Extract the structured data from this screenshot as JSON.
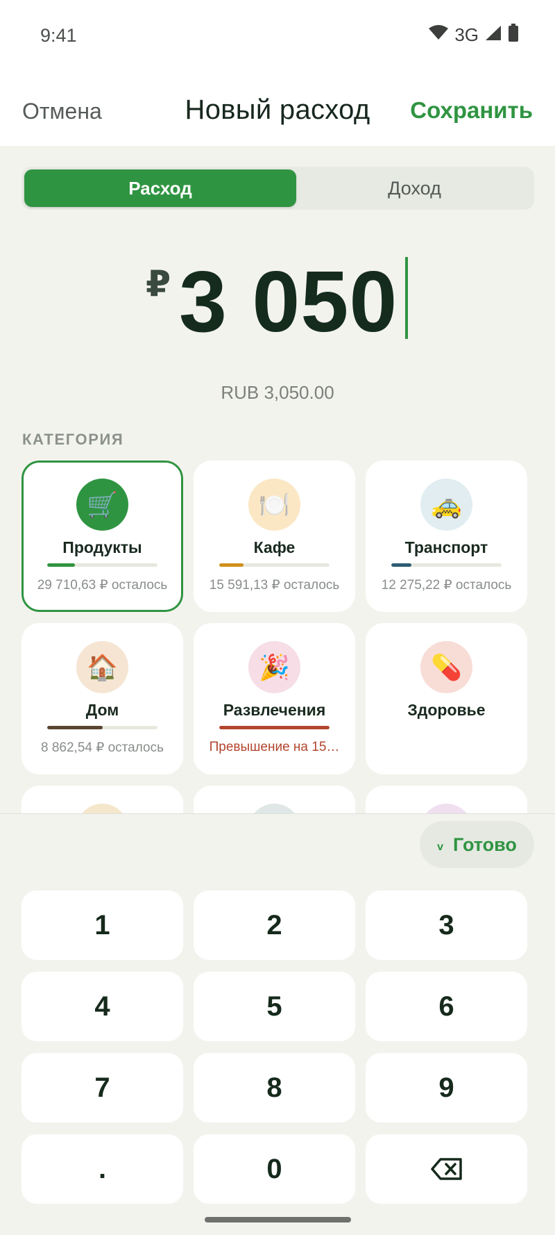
{
  "status_bar": {
    "time": "9:41",
    "network": "3G"
  },
  "header": {
    "cancel_label": "Отмена",
    "title": "Новый расход",
    "save_label": "Сохранить"
  },
  "type_switch": {
    "expense_label": "Расход",
    "income_label": "Доход",
    "selected": "expense"
  },
  "amount": {
    "currency_symbol": "₽",
    "value": "3 050",
    "formatted": "RUB 3,050.00"
  },
  "category_section": {
    "label": "КАТЕГОРИЯ",
    "items": [
      {
        "name": "Продукты",
        "icon": "🛒",
        "icon_name": "shopping-cart-icon",
        "subtitle": "29 710,63 ₽ осталось",
        "progress": 0.25,
        "bar_color": "#2f9441",
        "icon_bg": "#2f9441",
        "selected": true,
        "over_budget": false
      },
      {
        "name": "Кафе",
        "icon": "🍽️",
        "icon_name": "plate-cutlery-icon",
        "subtitle": "15 591,13 ₽ осталось",
        "progress": 0.22,
        "bar_color": "#d0901c",
        "icon_bg": "#fbe7c4",
        "selected": false,
        "over_budget": false
      },
      {
        "name": "Транспорт",
        "icon": "🚕",
        "icon_name": "taxi-icon",
        "subtitle": "12 275,22 ₽ осталось",
        "progress": 0.18,
        "bar_color": "#2d5d74",
        "icon_bg": "#e1edf1",
        "selected": false,
        "over_budget": false
      },
      {
        "name": "Дом",
        "icon": "🏠",
        "icon_name": "house-icon",
        "subtitle": "8 862,54 ₽ осталось",
        "progress": 0.5,
        "bar_color": "#5b4530",
        "icon_bg": "#f5e5d2",
        "selected": false,
        "over_budget": false
      },
      {
        "name": "Развлечения",
        "icon": "🎉",
        "icon_name": "party-popper-icon",
        "subtitle": "Превышение на 15…",
        "progress": 1.0,
        "bar_color": "#b3452e",
        "icon_bg": "#f6dde6",
        "selected": false,
        "over_budget": true
      },
      {
        "name": "Здоровье",
        "icon": "💊",
        "icon_name": "pill-icon",
        "subtitle": "",
        "progress": null,
        "bar_color": "",
        "icon_bg": "#f8dcd6",
        "selected": false,
        "over_budget": false
      }
    ]
  },
  "keypad": {
    "done_label": "Готово",
    "keys": [
      "1",
      "2",
      "3",
      "4",
      "5",
      "6",
      "7",
      "8",
      "9",
      ".",
      "0",
      "⌫"
    ]
  }
}
